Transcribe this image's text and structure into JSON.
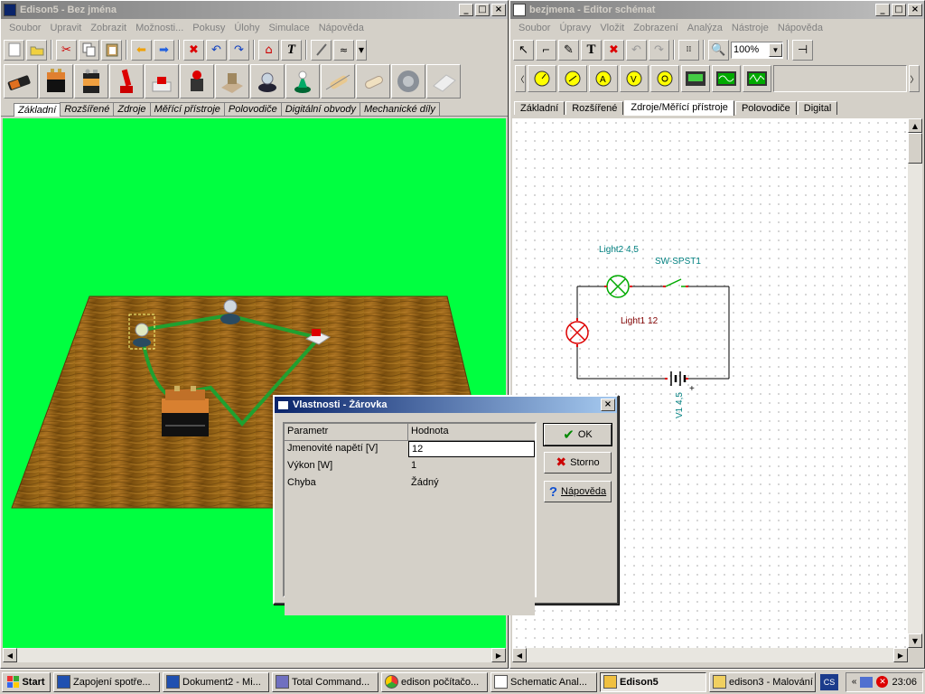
{
  "left": {
    "title": "Edison5 - Bez jména",
    "menu": [
      "Soubor",
      "Upravit",
      "Zobrazit",
      "Možnosti...",
      "Pokusy",
      "Úlohy",
      "Simulace",
      "Nápověda"
    ],
    "toolbar_icons": [
      "new-icon",
      "open-icon",
      "cut-icon",
      "copy-icon",
      "paste-icon",
      "back-icon",
      "forward-icon",
      "delete-icon",
      "undo-icon",
      "redo-icon",
      "home-icon",
      "text-icon",
      "probe-icon",
      "wave-icon",
      "dropdown-icon"
    ],
    "parts": [
      "battery-aa",
      "battery-9v-flat",
      "battery-9v",
      "knife-switch",
      "push-switch",
      "buzzer",
      "relay",
      "lamp-socket",
      "led",
      "resistor",
      "fuse",
      "motor",
      "plate"
    ],
    "tabs": [
      "Základní",
      "Rozšířené",
      "Zdroje",
      "Měřící přístroje",
      "Polovodiče",
      "Digitální obvody",
      "Mechanické díly"
    ],
    "selected_tab": 0,
    "bg_color": "#00ff40"
  },
  "right": {
    "title": "bezjmena - Editor schémat",
    "menu": [
      "Soubor",
      "Úpravy",
      "Vložit",
      "Zobrazení",
      "Analýza",
      "Nástroje",
      "Nápověda"
    ],
    "zoom": "100%",
    "toolbar_icons": [
      "pointer-icon",
      "wire-icon",
      "pencil-icon",
      "text-icon",
      "delete-icon",
      "undo-icon",
      "redo-icon",
      "grid-icon",
      "zoom-icon",
      "probe-icon"
    ],
    "instruments": [
      "voltmeter",
      "ammeter",
      "ampere-meter",
      "lamp-meter",
      "light-meter",
      "multimeter",
      "oscilloscope",
      "scope-2"
    ],
    "tabs": [
      "Základní",
      "Rozšířené",
      "Zdroje/Měřící přístroje",
      "Polovodiče",
      "Digital"
    ],
    "selected_tab": 2,
    "schematic": {
      "light2": "Light2 4,5",
      "switch": "SW-SPST1",
      "light1": "Light1 12",
      "battery": "V1 4,5",
      "plus": "+"
    }
  },
  "dialog": {
    "title": "Vlastnosti - Žárovka",
    "col_param": "Parametr",
    "col_value": "Hodnota",
    "rows": [
      {
        "param": "Jmenovité napětí [V]",
        "value": "12"
      },
      {
        "param": "Výkon [W]",
        "value": "1"
      },
      {
        "param": "Chyba",
        "value": "Žádný"
      }
    ],
    "ok": "OK",
    "cancel": "Storno",
    "help": "Nápověda"
  },
  "taskbar": {
    "start": "Start",
    "tasks": [
      "Zapojení spotře...",
      "Dokument2 - Mi...",
      "Total Command...",
      "edison počítačo...",
      "Schematic Anal...",
      "Edison5",
      "edison3 - Malování"
    ],
    "active_task": 5,
    "lang": "CS",
    "clock": "23:06"
  }
}
